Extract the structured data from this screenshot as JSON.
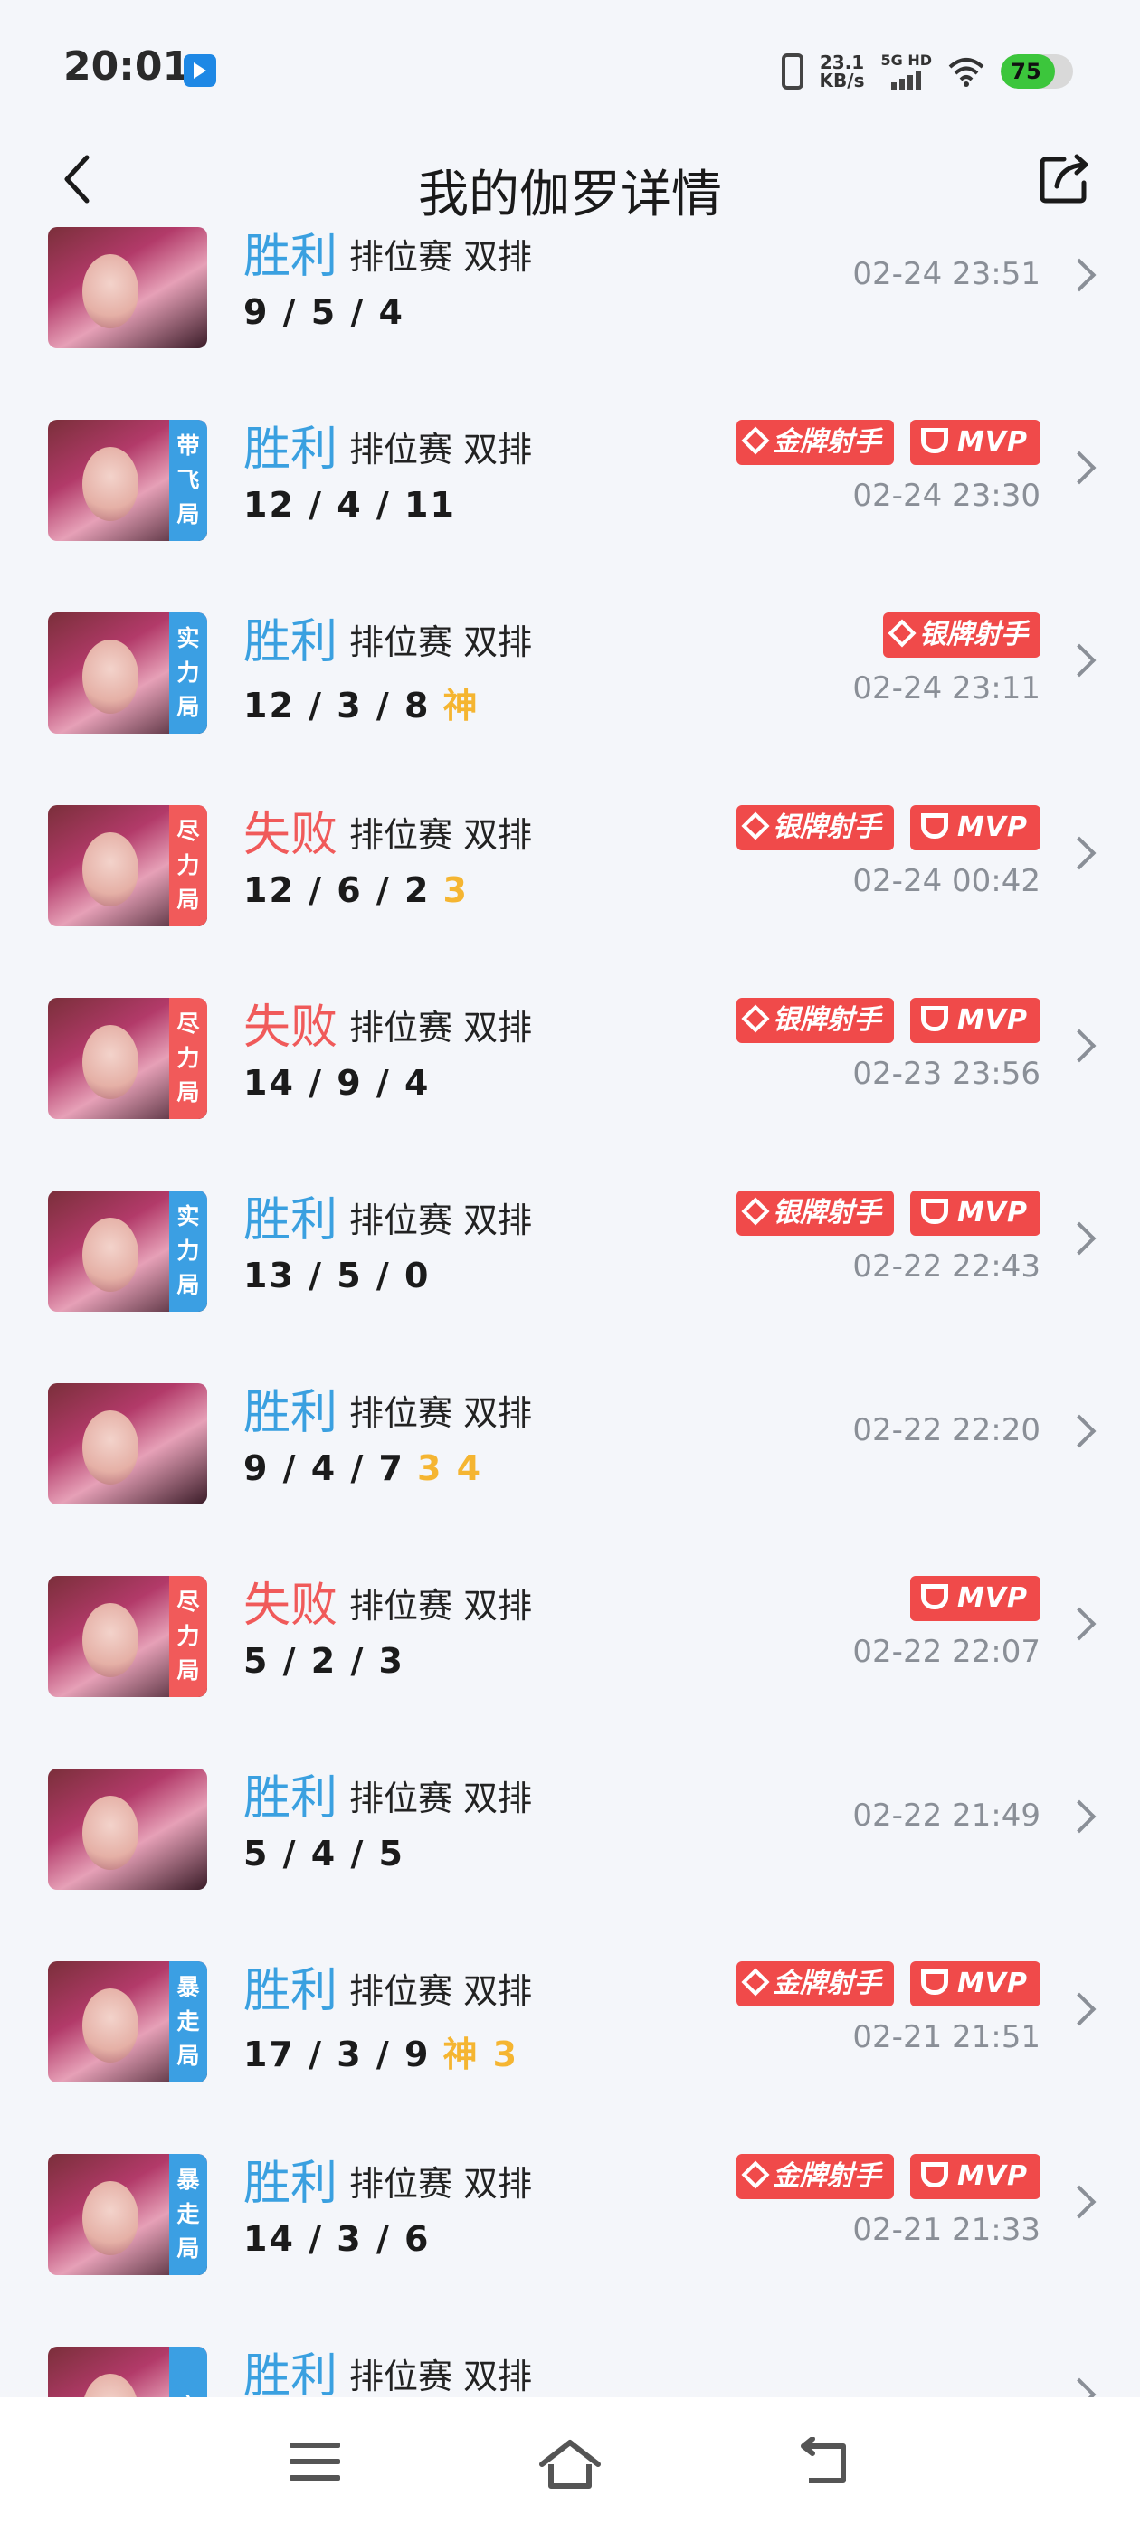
{
  "status_bar": {
    "time": "20:01",
    "net_speed_value": "23.1",
    "net_speed_unit": "KB/s",
    "signal_label": "5G HD",
    "battery": "75",
    "battery_level": 0.75
  },
  "header": {
    "title": "我的伽罗详情"
  },
  "matches": [
    {
      "result": "胜利",
      "outcome": "win",
      "mode": "排位赛 双排",
      "kda": "9 / 5 / 4",
      "extra": "",
      "time": "02-24 23:51",
      "tag": [],
      "badges": []
    },
    {
      "result": "胜利",
      "outcome": "win",
      "mode": "排位赛 双排",
      "kda": "12 / 4 / 11",
      "extra": "",
      "time": "02-24 23:30",
      "tag": [
        "带",
        "飞",
        "局"
      ],
      "tag_color": "blue",
      "badges": [
        "金牌射手",
        "MVP"
      ]
    },
    {
      "result": "胜利",
      "outcome": "win",
      "mode": "排位赛 双排",
      "kda": "12 / 3 / 8",
      "extra": "神",
      "time": "02-24 23:11",
      "tag": [
        "实",
        "力",
        "局"
      ],
      "tag_color": "blue",
      "badges": [
        "银牌射手"
      ]
    },
    {
      "result": "失败",
      "outcome": "lose",
      "mode": "排位赛 双排",
      "kda": "12 / 6 / 2",
      "extra": "3",
      "time": "02-24 00:42",
      "tag": [
        "尽",
        "力",
        "局"
      ],
      "tag_color": "red",
      "badges": [
        "银牌射手",
        "MVP"
      ]
    },
    {
      "result": "失败",
      "outcome": "lose",
      "mode": "排位赛 双排",
      "kda": "14 / 9 / 4",
      "extra": "",
      "time": "02-23 23:56",
      "tag": [
        "尽",
        "力",
        "局"
      ],
      "tag_color": "red",
      "badges": [
        "银牌射手",
        "MVP"
      ]
    },
    {
      "result": "胜利",
      "outcome": "win",
      "mode": "排位赛 双排",
      "kda": "13 / 5 / 0",
      "extra": "",
      "time": "02-22 22:43",
      "tag": [
        "实",
        "力",
        "局"
      ],
      "tag_color": "blue",
      "badges": [
        "银牌射手",
        "MVP"
      ]
    },
    {
      "result": "胜利",
      "outcome": "win",
      "mode": "排位赛 双排",
      "kda": "9 / 4 / 7",
      "extra": "3 4",
      "time": "02-22 22:20",
      "tag": [],
      "badges": []
    },
    {
      "result": "失败",
      "outcome": "lose",
      "mode": "排位赛 双排",
      "kda": "5 / 2 / 3",
      "extra": "",
      "time": "02-22 22:07",
      "tag": [
        "尽",
        "力",
        "局"
      ],
      "tag_color": "red",
      "badges": [
        "MVP"
      ]
    },
    {
      "result": "胜利",
      "outcome": "win",
      "mode": "排位赛 双排",
      "kda": "5 / 4 / 5",
      "extra": "",
      "time": "02-22 21:49",
      "tag": [],
      "badges": []
    },
    {
      "result": "胜利",
      "outcome": "win",
      "mode": "排位赛 双排",
      "kda": "17 / 3 / 9",
      "extra": "神 3",
      "time": "02-21 21:51",
      "tag": [
        "暴",
        "走",
        "局"
      ],
      "tag_color": "blue",
      "badges": [
        "金牌射手",
        "MVP"
      ]
    },
    {
      "result": "胜利",
      "outcome": "win",
      "mode": "排位赛 双排",
      "kda": "14 / 3 / 6",
      "extra": "",
      "time": "02-21 21:33",
      "tag": [
        "暴",
        "走",
        "局"
      ],
      "tag_color": "blue",
      "badges": [
        "金牌射手",
        "MVP"
      ]
    },
    {
      "result": "胜利",
      "outcome": "win",
      "mode": "排位赛 双排",
      "kda": "",
      "extra": "",
      "time": "",
      "tag": [
        "实"
      ],
      "tag_color": "blue",
      "badges": []
    }
  ],
  "icons": {
    "back": "back-arrow-icon",
    "share": "share-icon",
    "chevron": "chevron-right-icon",
    "nav_menu": "menu-icon",
    "nav_home": "home-icon",
    "nav_back": "back-icon"
  }
}
